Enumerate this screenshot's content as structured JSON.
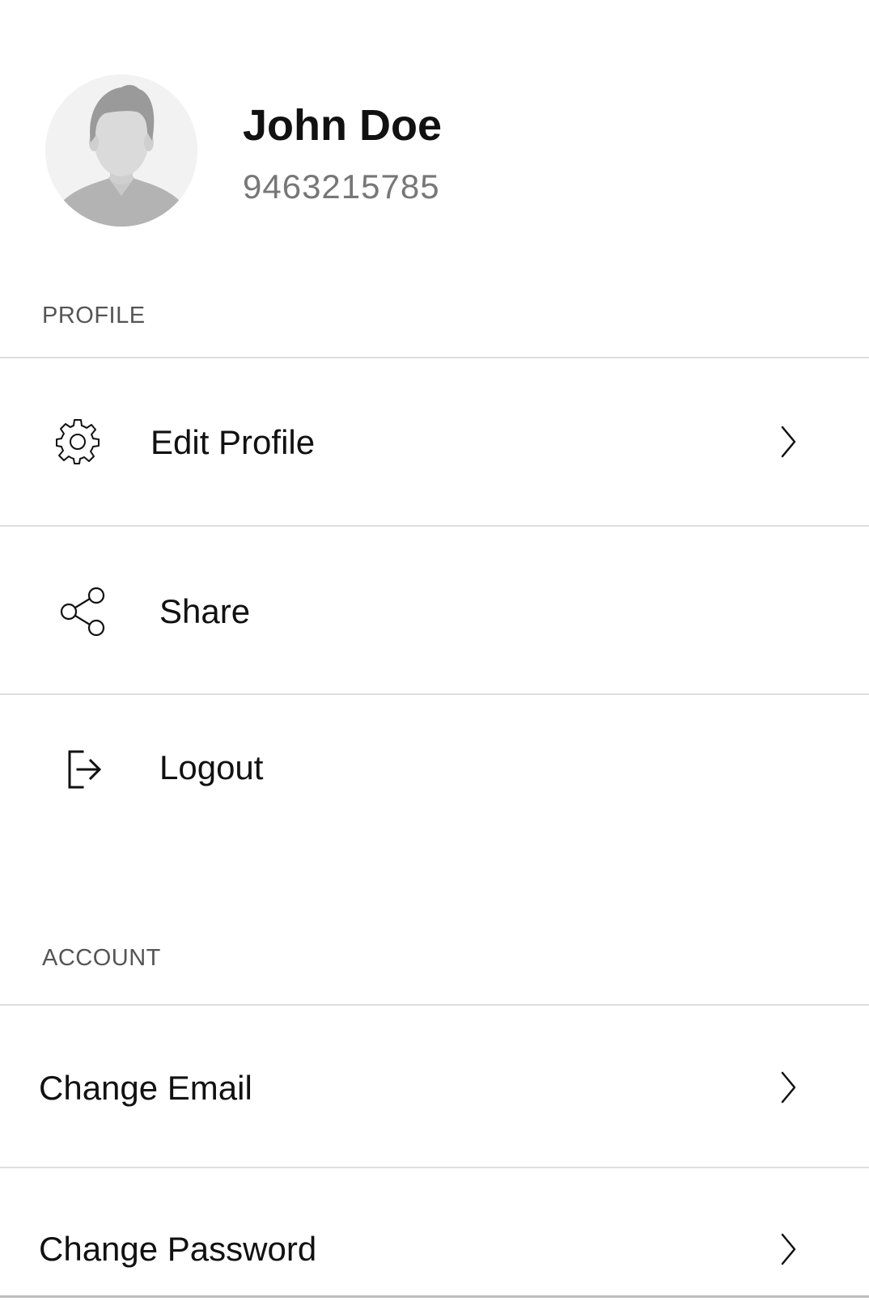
{
  "user": {
    "name": "John Doe",
    "phone": "9463215785"
  },
  "sections": {
    "profile": {
      "label": "PROFILE",
      "items": [
        {
          "label": "Edit Profile",
          "icon": "gear-icon",
          "chevron": true
        },
        {
          "label": "Share",
          "icon": "share-icon",
          "chevron": false
        },
        {
          "label": "Logout",
          "icon": "logout-icon",
          "chevron": false
        }
      ]
    },
    "account": {
      "label": "ACCOUNT",
      "items": [
        {
          "label": "Change Email",
          "chevron": true
        },
        {
          "label": "Change Password",
          "chevron": true
        }
      ]
    }
  },
  "colors": {
    "text_primary": "#111111",
    "text_secondary": "#777777",
    "section_label": "#555555",
    "divider": "#dedede",
    "avatar_bg": "#f2f2f2",
    "avatar_figure": "#b3b3b3"
  }
}
